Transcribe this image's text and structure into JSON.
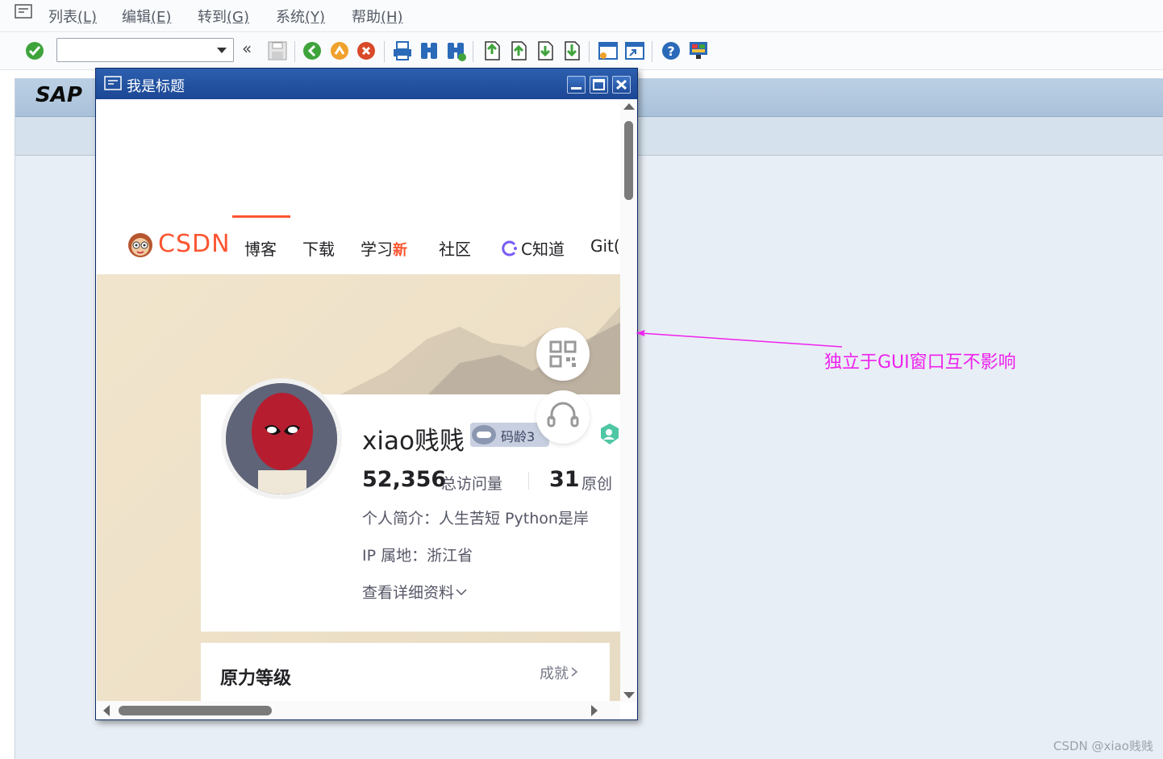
{
  "menubar": {
    "items": [
      {
        "label": "列表",
        "key": "(L)"
      },
      {
        "label": "编辑",
        "key": "(E)"
      },
      {
        "label": "转到",
        "key": "(G)"
      },
      {
        "label": "系统",
        "key": "(Y)"
      },
      {
        "label": "帮助",
        "key": "(H)"
      }
    ]
  },
  "toolbar": {
    "command_field_value": "",
    "collapse_label": "«",
    "icons": [
      "enter-check-icon",
      "save-icon",
      "back-icon",
      "exit-icon",
      "cancel-icon",
      "print-icon",
      "find-icon",
      "find-next-icon",
      "first-page-icon",
      "previous-page-icon",
      "next-page-icon",
      "last-page-icon",
      "create-session-icon",
      "shortcut-icon",
      "help-icon",
      "customize-layout-icon"
    ]
  },
  "sap": {
    "logo": "SAP"
  },
  "popup": {
    "title": "我是标题",
    "window_buttons": [
      "minimize-icon",
      "maximize-icon",
      "close-icon"
    ]
  },
  "csdn": {
    "logo_text": "CSDN",
    "nav": [
      {
        "label": "博客"
      },
      {
        "label": "下载"
      },
      {
        "label": "学习",
        "badge": "新"
      },
      {
        "label": "社区"
      },
      {
        "label": "C知道"
      },
      {
        "label": "Git("
      }
    ],
    "profile": {
      "username": "xiao贱贱",
      "code_age_badge": "码龄3",
      "visits_value": "52,356",
      "visits_label": "总访问量",
      "original_value": "31",
      "original_label": "原创",
      "bio": "个人简介：人生苦短 Python是岸",
      "ip": "IP 属地：浙江省",
      "detail_link": "查看详细资料"
    },
    "level_section": {
      "title": "原力等级",
      "achievement_link": "成就"
    }
  },
  "annotation": {
    "text": "独立于GUI窗口互不影响",
    "color": "#ee22ee"
  },
  "watermark": "CSDN @xiao贱贱",
  "colors": {
    "csdn_accent": "#fc5531",
    "popup_title": "#1f4c9a",
    "sap_header": "#a9c1da"
  }
}
